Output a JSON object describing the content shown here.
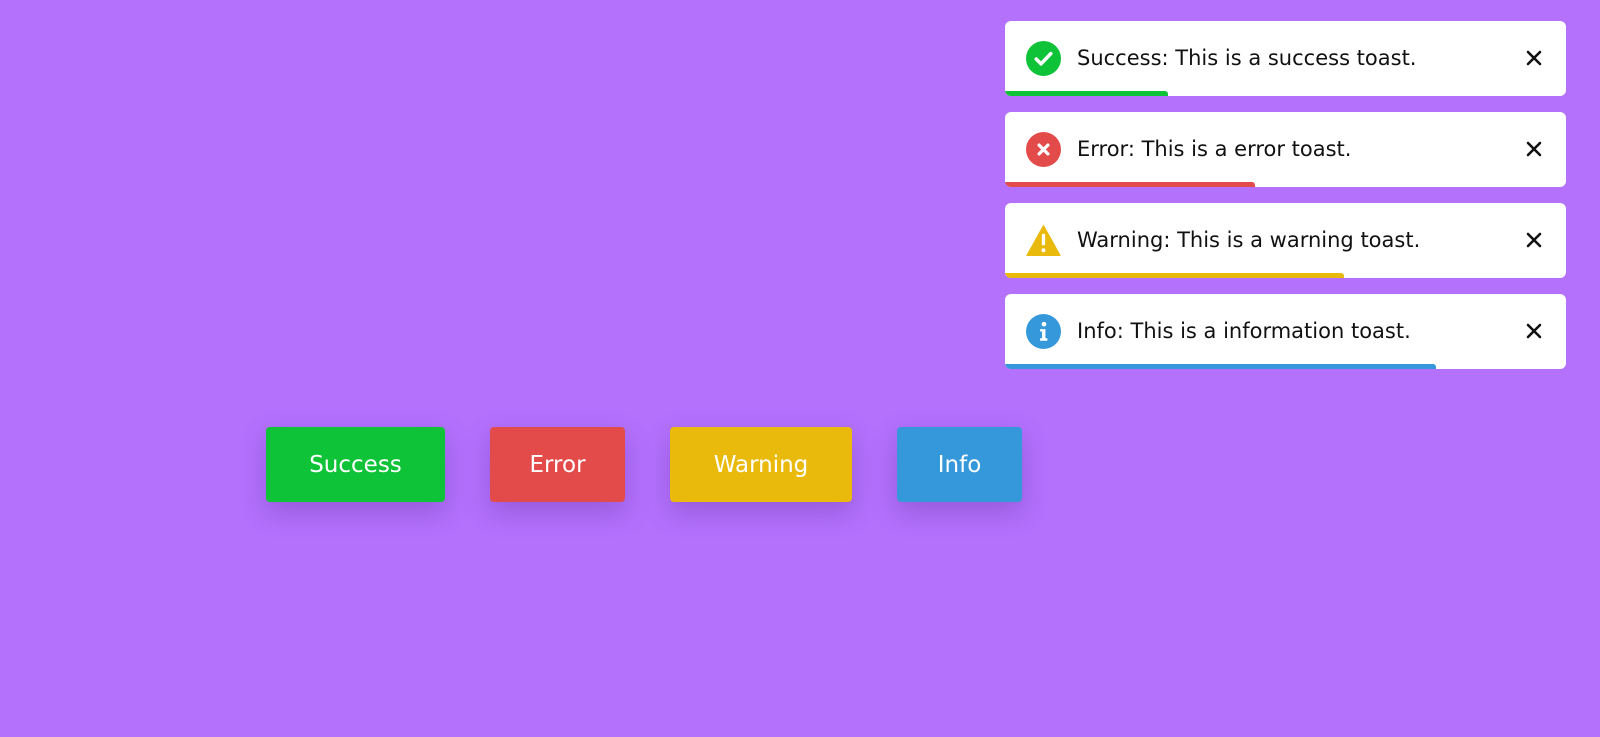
{
  "toasts": [
    {
      "type": "success",
      "message": "Success: This is a success toast.",
      "color": "#0ec337",
      "icon": "check-circle-icon",
      "progress": 0.29
    },
    {
      "type": "error",
      "message": "Error: This is a error toast.",
      "color": "#e34b4b",
      "icon": "x-circle-icon",
      "progress": 0.445
    },
    {
      "type": "warning",
      "message": "Warning: This is a warning toast.",
      "color": "#e9b90b",
      "icon": "warning-triangle-icon",
      "progress": 0.605
    },
    {
      "type": "info",
      "message": "Info: This is a information toast.",
      "color": "#3498db",
      "icon": "info-circle-icon",
      "progress": 0.768
    }
  ],
  "close_icon": "close-icon",
  "buttons": {
    "success": {
      "label": "Success",
      "color": "#0ec337"
    },
    "error": {
      "label": "Error",
      "color": "#e34b4b"
    },
    "warning": {
      "label": "Warning",
      "color": "#e9b90b"
    },
    "info": {
      "label": "Info",
      "color": "#3498db"
    }
  },
  "background_color": "#b371fc"
}
